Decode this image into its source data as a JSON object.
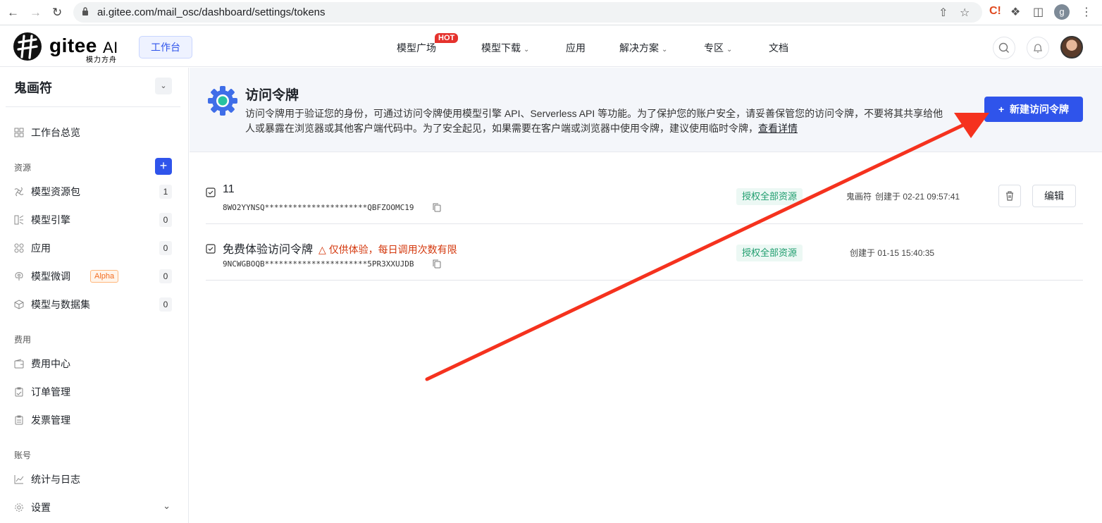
{
  "browser": {
    "url": "ai.gitee.com/mail_osc/dashboard/settings/tokens",
    "profile_initial": "g",
    "ext_label": "C!"
  },
  "topnav": {
    "logo_word": "gitee",
    "logo_ai": "AI",
    "logo_sub": "模力方舟",
    "workbench": "工作台",
    "menu": [
      "模型广场",
      "模型下载",
      "应用",
      "解决方案",
      "专区",
      "文档"
    ],
    "hot_badge": "HOT"
  },
  "sidebar": {
    "user": "鬼画符",
    "overview": "工作台总览",
    "section_resources": "资源",
    "resources": [
      {
        "label": "模型资源包",
        "count": "1"
      },
      {
        "label": "模型引擎",
        "count": "0"
      },
      {
        "label": "应用",
        "count": "0"
      },
      {
        "label": "模型微调",
        "count": "0",
        "badge": "Alpha"
      },
      {
        "label": "模型与数据集",
        "count": "0"
      }
    ],
    "section_billing": "费用",
    "billing": [
      "费用中心",
      "订单管理",
      "发票管理"
    ],
    "section_account": "账号",
    "account": [
      "统计与日志",
      "设置"
    ]
  },
  "banner": {
    "title": "访问令牌",
    "desc": "访问令牌用于验证您的身份，可通过访问令牌使用模型引擎 API、Serverless API 等功能。为了保护您的账户安全，请妥善保管您的访问令牌，不要将其共享给他人或暴露在浏览器或其他客户端代码中。为了安全起见，如果需要在客户端或浏览器中使用令牌，建议使用临时令牌，",
    "link": "查看详情",
    "new_button": "新建访问令牌"
  },
  "tokens": [
    {
      "name": "11",
      "key": "8WO2YYNSQ**********************QBFZOOMC19",
      "scope": "授权全部资源",
      "owner": "鬼画符",
      "created": "创建于 02-21 09:57:41",
      "edit": "编辑"
    },
    {
      "name": "免费体验访问令牌",
      "warning": "仅供体验，每日调用次数有限",
      "key": "9NCWGBOQB**********************5PR3XXUJDB",
      "scope": "授权全部资源",
      "created": "创建于 01-15 15:40:35"
    }
  ],
  "colors": {
    "primary": "#2f54eb",
    "annotation_arrow": "#f5321e",
    "scope_green": "#1f9d6e",
    "warning": "#d4380d"
  }
}
